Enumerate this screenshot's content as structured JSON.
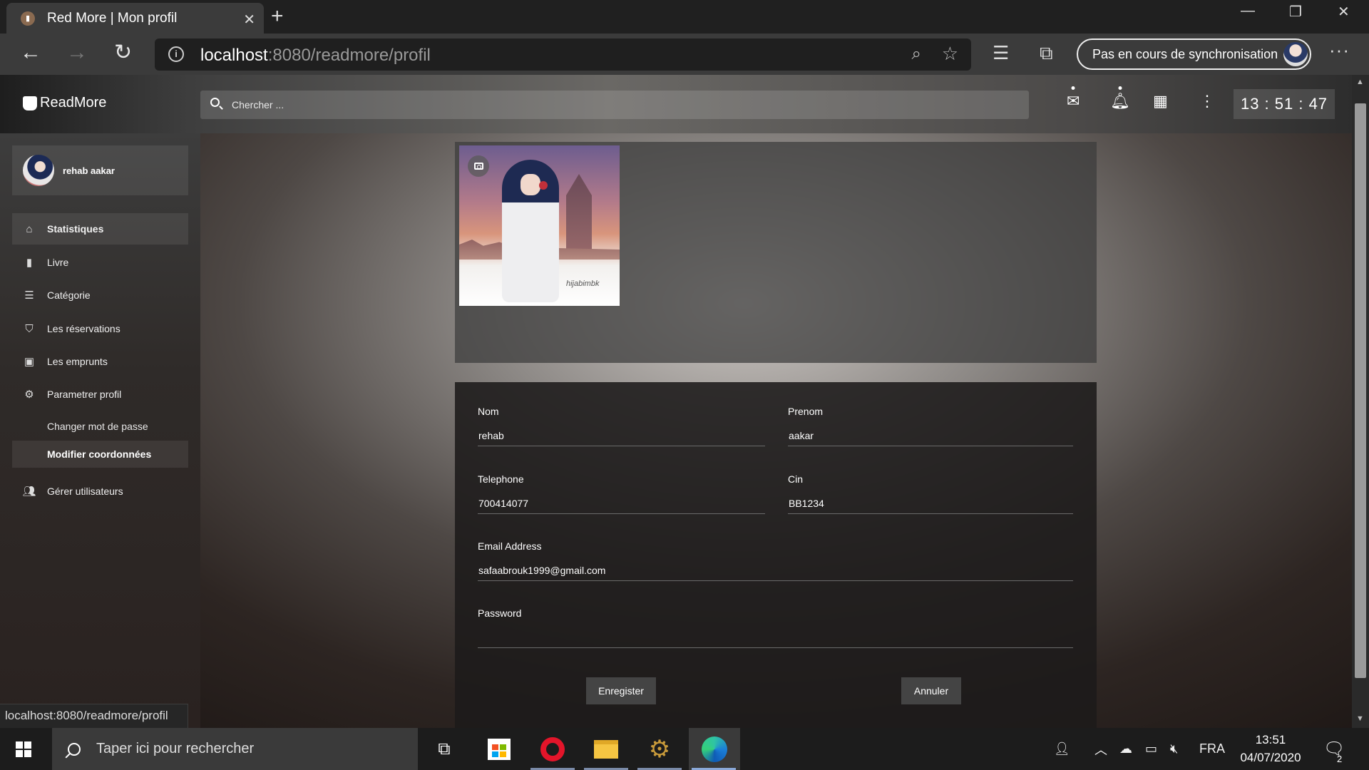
{
  "browser": {
    "tab_title": "Red More | Mon profil",
    "url_host": "localhost",
    "url_path": ":8080/readmore/profil",
    "sync_label": "Pas en cours de synchronisation"
  },
  "app": {
    "logo": "ReadMore",
    "search_placeholder": "Chercher ...",
    "clock": "13 : 51 : 47"
  },
  "sidebar": {
    "user_name": "rehab aakar",
    "items": [
      {
        "label": "Statistiques",
        "icon": "home-icon"
      },
      {
        "label": "Livre",
        "icon": "book-icon"
      },
      {
        "label": "Catégorie",
        "icon": "list-icon"
      },
      {
        "label": "Les réservations",
        "icon": "shield-check-icon"
      },
      {
        "label": "Les emprunts",
        "icon": "calendar-check-icon"
      },
      {
        "label": "Parametrer profil",
        "icon": "gear-icon"
      }
    ],
    "sub_items": [
      {
        "label": "Changer mot de passe"
      },
      {
        "label": "Modifier coordonnées"
      }
    ],
    "users_item": {
      "label": "Gérer utilisateurs",
      "icon": "users-icon"
    }
  },
  "form": {
    "nom_label": "Nom",
    "nom_value": "rehab",
    "prenom_label": "Prenom",
    "prenom_value": "aakar",
    "telephone_label": "Telephone",
    "telephone_value": "700414077",
    "cin_label": "Cin",
    "cin_value": "BB1234",
    "email_label": "Email Address",
    "email_value": "safaabrouk1999@gmail.com",
    "password_label": "Password",
    "password_value": "",
    "save_label": "Enregister",
    "cancel_label": "Annuler"
  },
  "photo": {
    "signature": "hijabimbk"
  },
  "status_url": "localhost:8080/readmore/profil",
  "taskbar": {
    "search_placeholder": "Taper ici pour rechercher",
    "language": "FRA",
    "time": "13:51",
    "date": "04/07/2020",
    "notification_count": "2"
  }
}
